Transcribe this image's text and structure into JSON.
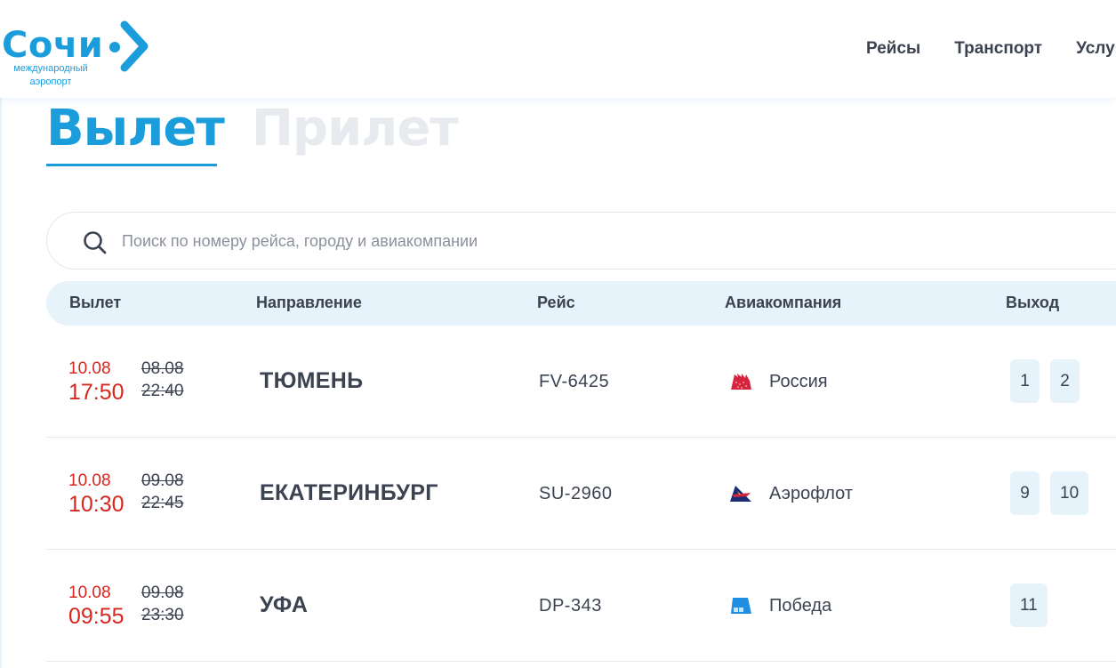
{
  "header": {
    "logo": {
      "title": "Сочи",
      "subtitle_line1": "международный",
      "subtitle_line2": "аэропорт",
      "brand_color": "#1c9ddb"
    },
    "nav": [
      {
        "label": "Рейсы"
      },
      {
        "label": "Транспорт"
      },
      {
        "label": "Услуги"
      }
    ]
  },
  "tabs": {
    "departures": "Вылет",
    "arrivals": "Прилет",
    "active": "departures"
  },
  "search": {
    "placeholder": "Поиск по номеру рейса, городу и авиакомпании",
    "value": "",
    "icon": "search-icon"
  },
  "table": {
    "columns": {
      "time": "Вылет",
      "destination": "Направление",
      "flight": "Рейс",
      "airline": "Авиакомпания",
      "gate": "Выход"
    },
    "rows": [
      {
        "new_date": "10.08",
        "new_time": "17:50",
        "old_date": "08.08",
        "old_time": "22:40",
        "destination": "ТЮМЕНЬ",
        "flight": "FV-6425",
        "airline": "Россия",
        "airline_logo": "rossiya-logo-icon",
        "gates": [
          "1",
          "2"
        ]
      },
      {
        "new_date": "10.08",
        "new_time": "10:30",
        "old_date": "09.08",
        "old_time": "22:45",
        "destination": "ЕКАТЕРИНБУРГ",
        "flight": "SU-2960",
        "airline": "Аэрофлот",
        "airline_logo": "aeroflot-logo-icon",
        "gates": [
          "9",
          "10"
        ]
      },
      {
        "new_date": "10.08",
        "new_time": "09:55",
        "old_date": "09.08",
        "old_time": "23:30",
        "destination": "УФА",
        "flight": "DP-343",
        "airline": "Победа",
        "airline_logo": "pobeda-logo-icon",
        "gates": [
          "11"
        ]
      }
    ]
  },
  "colors": {
    "accent": "#1c9ddb",
    "delayed_time": "#d7261e",
    "text": "#3b4250",
    "header_bg": "#e6f3fb",
    "inactive_tab": "#e7eaee"
  }
}
